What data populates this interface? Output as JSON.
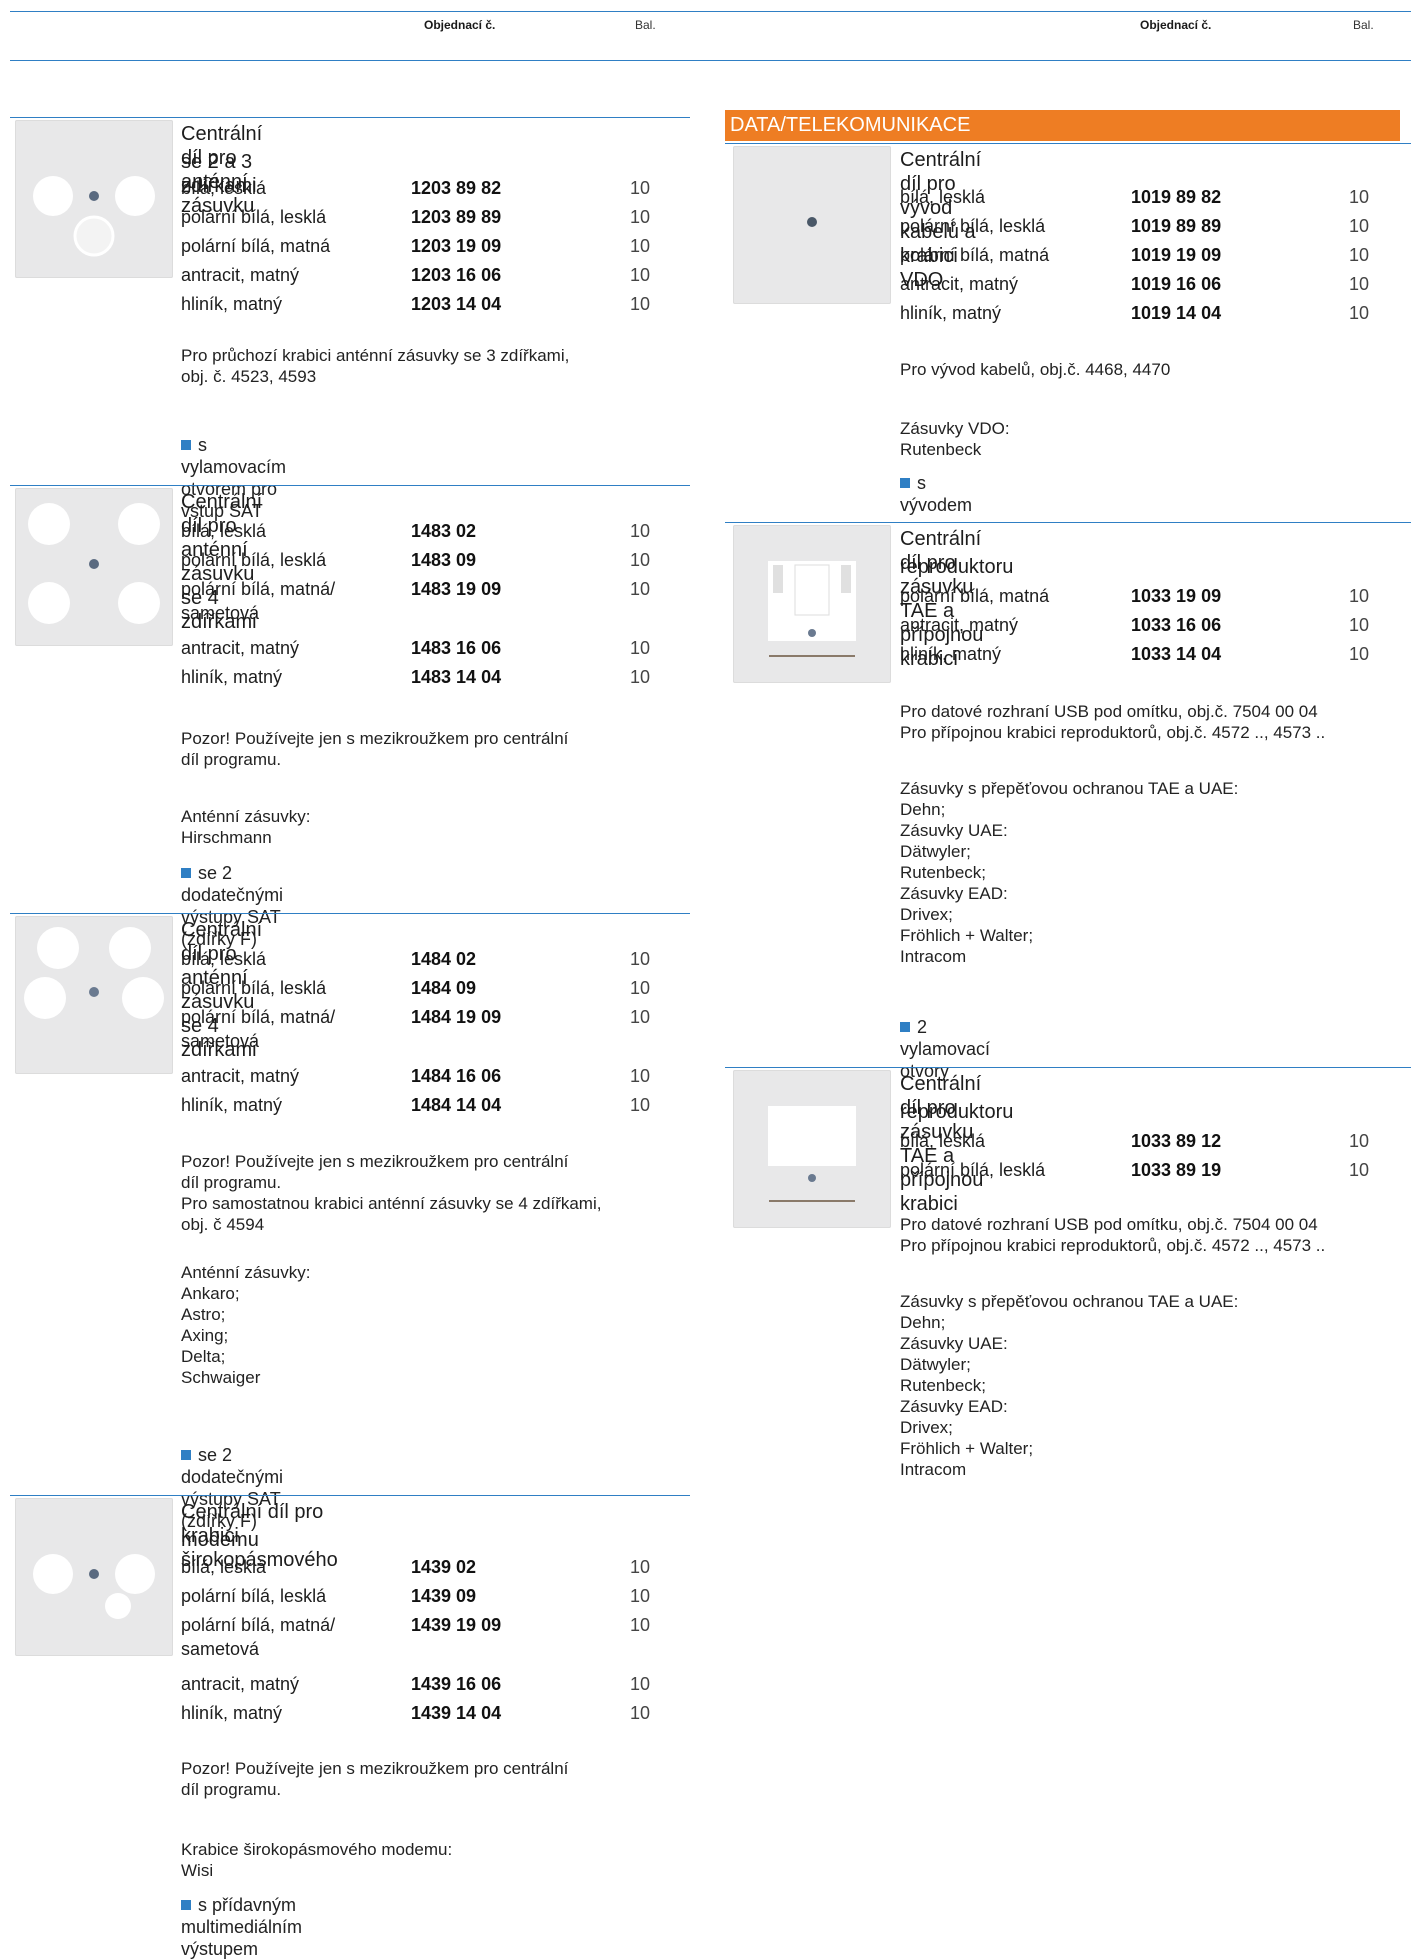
{
  "header": {
    "order_label": "Objednací č.",
    "pack_label": "Bal."
  },
  "section_title": "DATA/TELEKOMUNIKACE",
  "products_left": [
    {
      "title": [
        "Centrální díl pro anténní zásuvku",
        "se 2 a 3 zdířkami"
      ],
      "rows": [
        {
          "name": [
            "bílá, lesklá"
          ],
          "code": "1203 89 82",
          "qty": "10"
        },
        {
          "name": [
            "polární bílá, lesklá"
          ],
          "code": "1203 89 89",
          "qty": "10"
        },
        {
          "name": [
            "polární bílá, matná"
          ],
          "code": "1203 19 09",
          "qty": "10"
        },
        {
          "name": [
            "antracit, matný"
          ],
          "code": "1203 16 06",
          "qty": "10"
        },
        {
          "name": [
            "hliník, matný"
          ],
          "code": "1203 14 04",
          "qty": "10"
        }
      ],
      "notes": [
        "Pro průchozí krabici anténní zásuvky se 3 zdířkami,\nobj. č. 4523, 4593"
      ],
      "feature": "s vylamovacím otvorem pro vstup SAT"
    },
    {
      "title": [
        "Centrální díl pro anténní zásuvku se 4 zdířkami"
      ],
      "rows": [
        {
          "name": [
            "bílá, lesklá"
          ],
          "code": "1483 02",
          "qty": "10"
        },
        {
          "name": [
            "polární bílá, lesklá"
          ],
          "code": "1483 09",
          "qty": "10"
        },
        {
          "name": [
            "polární bílá, matná/",
            "sametová"
          ],
          "code": "1483 19 09",
          "qty": "10"
        },
        {
          "name": [
            "antracit, matný"
          ],
          "code": "1483 16 06",
          "qty": "10"
        },
        {
          "name": [
            "hliník, matný"
          ],
          "code": "1483 14 04",
          "qty": "10"
        }
      ],
      "notes": [
        "Pozor! Používejte jen s mezikroužkem pro centrální\ndíl programu.",
        "Anténní zásuvky:\nHirschmann"
      ],
      "feature": "se 2 dodatečnými výstupy SAT (zdířky F)"
    },
    {
      "title": [
        "Centrální díl pro anténní zásuvku se 4 zdířkami"
      ],
      "rows": [
        {
          "name": [
            "bílá, lesklá"
          ],
          "code": "1484 02",
          "qty": "10"
        },
        {
          "name": [
            "polární bílá, lesklá"
          ],
          "code": "1484 09",
          "qty": "10"
        },
        {
          "name": [
            "polární bílá, matná/",
            "sametová"
          ],
          "code": "1484 19 09",
          "qty": "10"
        },
        {
          "name": [
            "antracit, matný"
          ],
          "code": "1484 16 06",
          "qty": "10"
        },
        {
          "name": [
            "hliník, matný"
          ],
          "code": "1484 14 04",
          "qty": "10"
        }
      ],
      "notes": [
        "Pozor! Používejte jen s mezikroužkem pro centrální\ndíl programu.\nPro samostatnou krabici anténní zásuvky se 4 zdířkami,\nobj. č 4594",
        "Anténní zásuvky:\nAnkaro;\nAstro;\nAxing;\nDelta;\nSchwaiger"
      ],
      "feature": "se 2 dodatečnými výstupy SAT (zdířky F)"
    },
    {
      "title": [
        "Centrální díl pro krabici širokopásmového",
        "modemu"
      ],
      "rows": [
        {
          "name": [
            "bílá, lesklá"
          ],
          "code": "1439 02",
          "qty": "10"
        },
        {
          "name": [
            "polární bílá, lesklá"
          ],
          "code": "1439 09",
          "qty": "10"
        },
        {
          "name": [
            "polární bílá, matná/",
            "sametová"
          ],
          "code": "1439 19 09",
          "qty": "10"
        },
        {
          "name": [
            "antracit, matný"
          ],
          "code": "1439 16 06",
          "qty": "10"
        },
        {
          "name": [
            "hliník, matný"
          ],
          "code": "1439 14 04",
          "qty": "10"
        }
      ],
      "notes": [
        "Pozor! Používejte jen s mezikroužkem pro centrální\ndíl programu.",
        "Krabice širokopásmového modemu:\nWisi"
      ],
      "feature": "s přídavným multimediálním výstupem"
    }
  ],
  "products_right": [
    {
      "title": [
        "Centrální díl pro vývod kabelů a krabici VDO"
      ],
      "rows": [
        {
          "name": [
            "bílá, lesklá"
          ],
          "code": "1019 89 82",
          "qty": "10"
        },
        {
          "name": [
            "polární bílá, lesklá"
          ],
          "code": "1019 89 89",
          "qty": "10"
        },
        {
          "name": [
            "polární bílá, matná"
          ],
          "code": "1019 19 09",
          "qty": "10"
        },
        {
          "name": [
            "antracit, matný"
          ],
          "code": "1019 16 06",
          "qty": "10"
        },
        {
          "name": [
            "hliník, matný"
          ],
          "code": "1019 14 04",
          "qty": "10"
        }
      ],
      "notes": [
        "Pro vývod kabelů, obj.č. 4468, 4470",
        "Zásuvky VDO:\nRutenbeck"
      ],
      "feature": "s vývodem"
    },
    {
      "title": [
        "Centrální díl pro zásuvku TAE a přípojnou krabici",
        "reproduktoru"
      ],
      "rows": [
        {
          "name": [
            "polární bílá, matná"
          ],
          "code": "1033 19 09",
          "qty": "10"
        },
        {
          "name": [
            "antracit, matný"
          ],
          "code": "1033 16 06",
          "qty": "10"
        },
        {
          "name": [
            "hliník, matný"
          ],
          "code": "1033 14 04",
          "qty": "10"
        }
      ],
      "notes": [
        "Pro datové rozhraní USB pod omítku, obj.č. 7504 00 04\nPro přípojnou krabici reproduktorů, obj.č. 4572 .., 4573 ..",
        "Zásuvky s přepěťovou ochranou TAE a UAE:\nDehn;\nZásuvky UAE:\nDätwyler;\nRutenbeck;\nZásuvky EAD:\nDrivex;\nFröhlich + Walter;\nIntracom"
      ],
      "feature": "2 vylamovací otvory"
    },
    {
      "title": [
        "Centrální díl pro zásuvku TAE a přípojnou krabici",
        "reproduktoru"
      ],
      "rows": [
        {
          "name": [
            "bílá, lesklá"
          ],
          "code": "1033 89 12",
          "qty": "10"
        },
        {
          "name": [
            "polární bílá, lesklá"
          ],
          "code": "1033 89 19",
          "qty": "10"
        }
      ],
      "notes": [
        "Pro datové rozhraní USB pod omítku, obj.č. 7504 00 04\nPro přípojnou krabici reproduktorů, obj.č. 4572 .., 4573 ..",
        "Zásuvky s přepěťovou ochranou TAE a UAE:\nDehn;\nZásuvky UAE:\nDätwyler;\nRutenbeck;\nZásuvky EAD:\nDrivex;\nFröhlich + Walter;\nIntracom"
      ],
      "feature": ""
    }
  ]
}
